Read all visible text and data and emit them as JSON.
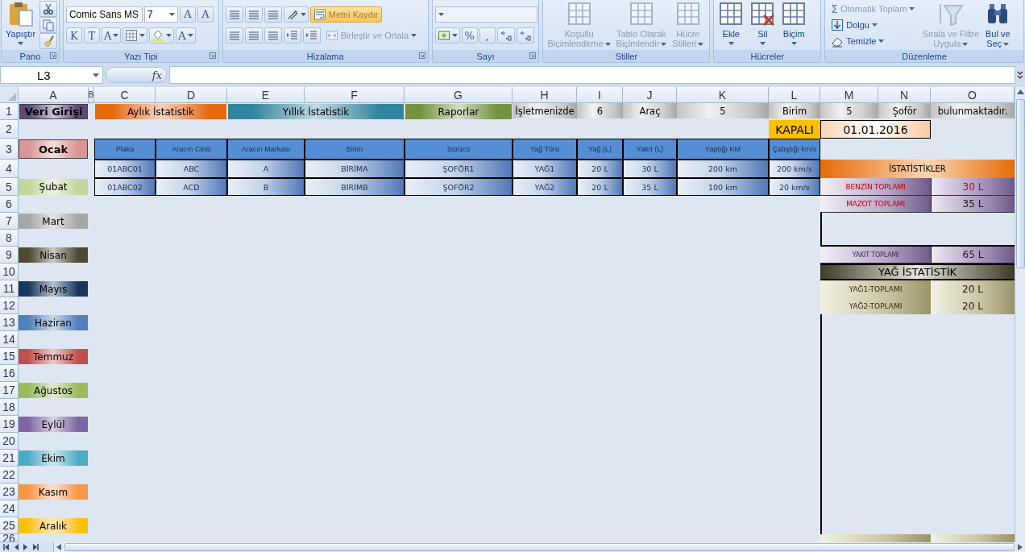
{
  "ribbon": {
    "groups": [
      {
        "label": "Pano",
        "launcher": true,
        "columns": [
          {
            "kind": "large",
            "label": [
              "Yapıştır"
            ],
            "caret": true,
            "disabled": false
          },
          {
            "kind": "stack",
            "rows": [
              {
                "controls": [
                  {
                    "kind": "tool",
                    "disabled": false
                  }
                ]
              },
              {
                "controls": [
                  {
                    "kind": "tool",
                    "disabled": false
                  }
                ]
              },
              {
                "controls": [
                  {
                    "kind": "tool",
                    "disabled": false
                  }
                ]
              }
            ]
          }
        ]
      },
      {
        "label": "Yazı Tipi",
        "launcher": true,
        "columns": [
          {
            "kind": "stack",
            "rows": [
              {
                "controls": [
                  {
                    "kind": "combo",
                    "value": "Comic Sans MS",
                    "disabled": false
                  },
                  {
                    "kind": "combo",
                    "value": "7",
                    "disabled": false
                  },
                  {
                    "kind": "tool",
                    "text": "A",
                    "disabled": false
                  },
                  {
                    "kind": "tool",
                    "text": "A",
                    "disabled": false
                  }
                ]
              },
              {
                "controls": [
                  {
                    "kind": "tool",
                    "text": "K",
                    "disabled": false
                  },
                  {
                    "kind": "tool",
                    "text": "T",
                    "disabled": false
                  },
                  {
                    "kind": "tool",
                    "text": "A",
                    "caret": true,
                    "disabled": false
                  },
                  {
                    "kind": "tool",
                    "caret": true,
                    "disabled": false
                  },
                  {
                    "kind": "tool",
                    "caret": true,
                    "disabled": false
                  },
                  {
                    "kind": "tool",
                    "text": "A",
                    "caret": true,
                    "disabled": false
                  }
                ]
              }
            ]
          }
        ]
      },
      {
        "label": "Hizalama",
        "launcher": true,
        "columns": [
          {
            "kind": "stack",
            "rows": [
              {
                "controls": [
                  {
                    "kind": "tool",
                    "disabled": false
                  },
                  {
                    "kind": "tool",
                    "disabled": false
                  },
                  {
                    "kind": "tool",
                    "disabled": false
                  },
                  {
                    "kind": "tool",
                    "caret": true,
                    "disabled": false
                  },
                  {
                    "kind": "small",
                    "label": "Metni Kaydır",
                    "selected": true,
                    "disabled": false
                  }
                ]
              },
              {
                "controls": [
                  {
                    "kind": "tool",
                    "disabled": false
                  },
                  {
                    "kind": "tool",
                    "disabled": false
                  },
                  {
                    "kind": "tool",
                    "disabled": false
                  },
                  {
                    "kind": "tool",
                    "disabled": false
                  },
                  {
                    "kind": "tool",
                    "disabled": false
                  },
                  {
                    "kind": "small",
                    "label": "Birleştir ve Ortala",
                    "caret": true,
                    "selected": false,
                    "disabled": true
                  }
                ]
              }
            ]
          }
        ]
      },
      {
        "label": "Sayı",
        "launcher": true,
        "columns": [
          {
            "kind": "stack",
            "rows": [
              {
                "controls": [
                  {
                    "kind": "combo",
                    "disabled": true
                  }
                ]
              },
              {
                "controls": [
                  {
                    "kind": "tool",
                    "caret": true,
                    "disabled": false
                  },
                  {
                    "kind": "tool",
                    "text": "%",
                    "disabled": false
                  },
                  {
                    "kind": "tool",
                    "text": ",",
                    "disabled": false
                  },
                  {
                    "kind": "tool",
                    "disabled": false
                  },
                  {
                    "kind": "tool",
                    "disabled": false
                  }
                ]
              }
            ]
          }
        ]
      },
      {
        "label": "Stiller",
        "launcher": false,
        "columns": [
          {
            "kind": "large",
            "label": [
              "Koşullu",
              "Biçimlendirme"
            ],
            "caret": true,
            "disabled": true
          },
          {
            "kind": "large",
            "label": [
              "Tablo Olarak",
              "Biçimlendir"
            ],
            "caret": true,
            "disabled": true
          },
          {
            "kind": "large",
            "label": [
              "Hücre",
              "Stilleri"
            ],
            "caret": true,
            "disabled": true
          }
        ]
      },
      {
        "label": "Hücreler",
        "launcher": false,
        "columns": [
          {
            "kind": "large",
            "label": [
              "Ekle"
            ],
            "caret": true,
            "disabled": false
          },
          {
            "kind": "large",
            "label": [
              "Sil"
            ],
            "caret": true,
            "disabled": false
          },
          {
            "kind": "large",
            "label": [
              "Biçim"
            ],
            "caret": true,
            "disabled": false
          }
        ]
      },
      {
        "label": "Düzenleme",
        "launcher": false,
        "columns": [
          {
            "kind": "stack",
            "rows": [
              {
                "controls": [
                  {
                    "kind": "small",
                    "glyph": "Σ",
                    "label": "Otomatik Toplam",
                    "caret": true,
                    "selected": false,
                    "disabled": true
                  }
                ]
              },
              {
                "controls": [
                  {
                    "kind": "small",
                    "label": "Dolgu",
                    "caret": true,
                    "selected": false,
                    "disabled": false
                  }
                ]
              },
              {
                "controls": [
                  {
                    "kind": "small",
                    "label": "Temizle",
                    "caret": true,
                    "selected": false,
                    "disabled": false
                  }
                ]
              }
            ]
          },
          {
            "kind": "large",
            "label": [
              "Sırala ve Filtre",
              "Uygula"
            ],
            "caret": true,
            "disabled": true
          },
          {
            "kind": "large",
            "label": [
              "Bul ve",
              "Seç"
            ],
            "caret": true,
            "disabled": false
          }
        ]
      }
    ]
  },
  "formula_bar": {
    "name_box": "L3",
    "fx": "fx"
  },
  "columns": [
    "A",
    "B",
    "C",
    "D",
    "E",
    "F",
    "G",
    "H",
    "I",
    "J",
    "K",
    "L",
    "M",
    "N",
    "O"
  ],
  "rows": [
    "1",
    "2",
    "3",
    "4",
    "5",
    "6",
    "7",
    "8",
    "9",
    "10",
    "11",
    "12",
    "13",
    "14",
    "15",
    "16",
    "17",
    "18",
    "19",
    "20",
    "21",
    "22",
    "23",
    "24",
    "25",
    "26"
  ],
  "nav": [
    {
      "label": "Veri Girişi",
      "color": "#604a7b",
      "selected": true
    },
    {
      "label": "Aylık İstatistik",
      "color": "#e46c0a",
      "selected": false
    },
    {
      "label": "Yıllık İstatistik",
      "color": "#31859c",
      "selected": false
    },
    {
      "label": "Raporlar",
      "color": "#76923c",
      "selected": false
    }
  ],
  "info": [
    "İşletmenizde",
    "6",
    "Araç",
    "5",
    "Birim",
    "5",
    "Şoför",
    "bulunmaktadır."
  ],
  "status": "KAPALI",
  "date": "01.01.2016",
  "months": [
    {
      "label": "Ocak",
      "color": "#d99694",
      "selected": true
    },
    {
      "label": "Şubat",
      "color": "#c3d69b",
      "selected": false
    },
    {
      "label": "Mart",
      "color": "#a6a6a6",
      "selected": false
    },
    {
      "label": "Nisan",
      "color": "#4f4a32",
      "selected": false
    },
    {
      "label": "Mayıs",
      "color": "#17375e",
      "selected": false
    },
    {
      "label": "Haziran",
      "color": "#4f81bd",
      "selected": false
    },
    {
      "label": "Temmuz",
      "color": "#c0504d",
      "selected": false
    },
    {
      "label": "Ağustos",
      "color": "#9bbb59",
      "selected": false
    },
    {
      "label": "Eylül",
      "color": "#8064a2",
      "selected": false
    },
    {
      "label": "Ekim",
      "color": "#4bacc6",
      "selected": false
    },
    {
      "label": "Kasım",
      "color": "#f79646",
      "selected": false
    },
    {
      "label": "Aralık",
      "color": "#ffc000",
      "selected": false
    }
  ],
  "table": {
    "columns": [
      "Plaka",
      "Aracın Cinsi",
      "Aracın Markası",
      "Birim",
      "Sürücü",
      "Yağ Türü",
      "Yağ (L)",
      "Yakıt (L)",
      "Yaptığı KM",
      "Çalıştığı km/s"
    ],
    "rows": [
      [
        "01ABC01",
        "ABC",
        "A",
        "BİRİMA",
        "ŞOFÖR1",
        "YAĞ1",
        "20 L",
        "30 L",
        "200 km",
        "200 km/s"
      ],
      [
        "01ABC02",
        "ACD",
        "B",
        "BİRİMB",
        "ŞOFÖR2",
        "YAĞ2",
        "20 L",
        "35 L",
        "100 km",
        "20 km/s"
      ]
    ]
  },
  "stats": {
    "title": "İSTATİSTİKLER",
    "fuel": [
      {
        "label": "BENZİN TOPLAMI",
        "value": "30 L",
        "highlight": true
      },
      {
        "label": "MAZOT TOPLAMI",
        "value": "35 L",
        "highlight": false
      }
    ],
    "total": {
      "label": "YAKIT TOPLAMI",
      "value": "65 L"
    },
    "oil_title": "YAĞ İSTATİSTİK",
    "oil": [
      {
        "label": "YAĞ1-TOPLAMI",
        "value": "20 L"
      },
      {
        "label": "YAĞ2-TOPLAMI",
        "value": "20 L"
      }
    ]
  }
}
